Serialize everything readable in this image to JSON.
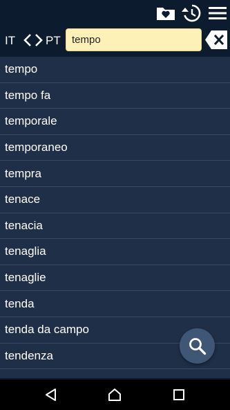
{
  "toolbar": {
    "icons": [
      "favorites-folder-icon",
      "history-icon",
      "menu-icon"
    ]
  },
  "search": {
    "source_lang": "IT",
    "target_lang": "PT",
    "value": "tempo"
  },
  "results": [
    "tempo",
    "tempo fa",
    "temporale",
    "temporaneo",
    "tempra",
    "tenace",
    "tenacia",
    "tenaglia",
    "tenaglie",
    "tenda",
    "tenda da campo",
    "tendenza"
  ],
  "colors": {
    "background": "#0d1b2e",
    "list_background": "#1f2f47",
    "search_field": "#fdf1b8",
    "fab": "#3f5675"
  }
}
